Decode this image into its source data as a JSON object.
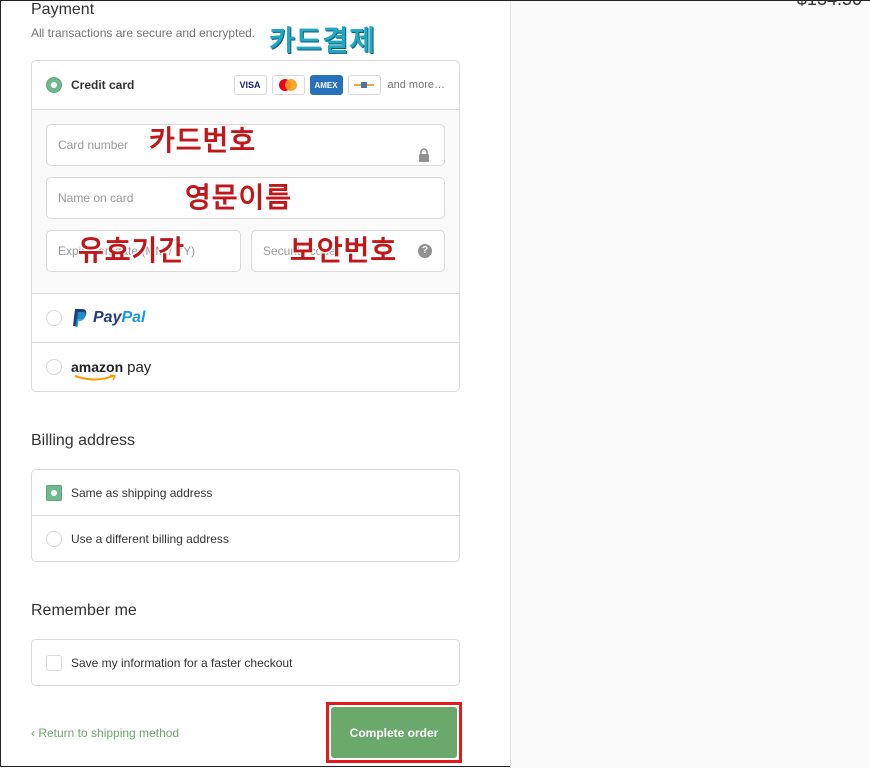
{
  "payment": {
    "title": "Payment",
    "subtitle": "All transactions are secure and encrypted.",
    "annotation": "카드결제",
    "credit_card": {
      "label": "Credit card",
      "brands": [
        "VISA",
        "",
        "AMEX",
        ""
      ],
      "more": "and more…",
      "card_number_placeholder": "Card number",
      "card_number_annotation": "카드번호",
      "name_placeholder": "Name on card",
      "name_annotation": "영문이름",
      "expiry_placeholder": "Expiration date (MM / YY)",
      "expiry_annotation": "유효기간",
      "security_placeholder": "Security code",
      "security_annotation": "보안번호"
    },
    "paypal": {
      "label_p1": "Pay",
      "label_p2": "Pal"
    },
    "amazon": {
      "label_a": "amazon",
      "label_b": "pay"
    }
  },
  "billing": {
    "title": "Billing address",
    "same_label": "Same as shipping address",
    "different_label": "Use a different billing address"
  },
  "remember": {
    "title": "Remember me",
    "save_label": "Save my information for a faster checkout"
  },
  "footer": {
    "return_label": "‹ Return to shipping method",
    "complete_label": "Complete order"
  },
  "summary": {
    "total": "$134.50"
  },
  "colors": {
    "accent": "#6aa86c",
    "highlight_border": "#e31b1b",
    "annotation_red": "#c0171b",
    "annotation_teal": "#1fa7c4"
  }
}
